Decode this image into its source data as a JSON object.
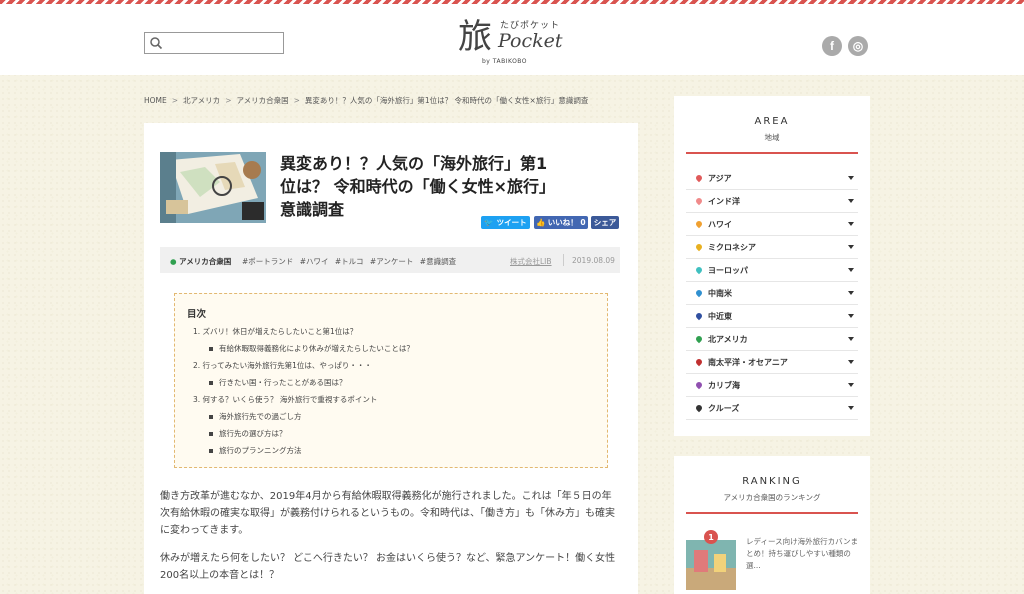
{
  "header": {
    "search_placeholder": "",
    "logo": {
      "kanji": "旅",
      "ruby": "たびポケット",
      "name": "Pocket",
      "by": "by TABIKOBO"
    },
    "social": {
      "facebook": "f",
      "instagram": "◎"
    }
  },
  "breadcrumb": [
    "HOME",
    "北アメリカ",
    "アメリカ合衆国",
    "異変あり！？人気の「海外旅行」第1位は？ 令和時代の「働く女性×旅行」意識調査"
  ],
  "article": {
    "title_lines": [
      "異変あり！？人気の「海外旅行」第1",
      "位は？ 令和時代の「働く女性×旅行」",
      "意識調査"
    ],
    "share": {
      "tweet": "ツイート",
      "like": "いいね！ 0",
      "share": "シェア"
    },
    "meta": {
      "area": "アメリカ合衆国",
      "tags": [
        "#ポートランド",
        "#ハワイ",
        "#トルコ",
        "#アンケート",
        "#意識調査"
      ],
      "company": "株式会社LIB",
      "date": "2019.08.09"
    },
    "toc": {
      "title": "目次",
      "items": [
        "1. ズバリ！休日が増えたらしたいこと第1位は？",
        "有給休暇取得義務化により休みが増えたらしたいことは？",
        "2. 行ってみたい海外旅行先第1位は、やっぱり・・・",
        "行きたい国・行ったことがある国は？",
        "3. 何する？いくら使う？ 海外旅行で重視するポイント",
        "海外旅行先での過ごし方",
        "旅行先の選び方は？",
        "旅行のプランニング方法"
      ]
    },
    "body": [
      "働き方改革が進むなか、2019年4月から有給休暇取得義務化が施行されました。これは「年５日の年次有給休暇の確実な取得」が義務付けられるというもの。令和時代は、「働き方」も「休み方」も確実に変わってきます。",
      "休みが増えたら何をしたい？ どこへ行きたい？ お金はいくら使う？など、緊急アンケート！働く女性200名以上の本音とは！？"
    ]
  },
  "sidebar": {
    "area": {
      "title_en": "AREA",
      "title_ja": "地域",
      "items": [
        {
          "label": "アジア",
          "color": "#e05a5a"
        },
        {
          "label": "インド洋",
          "color": "#f08a8a"
        },
        {
          "label": "ハワイ",
          "color": "#f0a030"
        },
        {
          "label": "ミクロネシア",
          "color": "#e8b020"
        },
        {
          "label": "ヨーロッパ",
          "color": "#40c0c0"
        },
        {
          "label": "中南米",
          "color": "#3090d0"
        },
        {
          "label": "中近東",
          "color": "#3050a0"
        },
        {
          "label": "北アメリカ",
          "color": "#30a050"
        },
        {
          "label": "南太平洋・オセアニア",
          "color": "#c03030"
        },
        {
          "label": "カリブ海",
          "color": "#9050b0"
        },
        {
          "label": "クルーズ",
          "color": "#333333"
        }
      ]
    },
    "ranking": {
      "title_en": "RANKING",
      "title_ja": "アメリカ合衆国のランキング",
      "first": {
        "num": "1",
        "text": "レディース向け海外旅行カバンまとめ！持ち運びしやすい種類の選..."
      }
    }
  },
  "colors": {
    "accent": "#d9534f",
    "tweet": "#1da1f2",
    "like": "#4267b2",
    "share": "#3b5998"
  }
}
